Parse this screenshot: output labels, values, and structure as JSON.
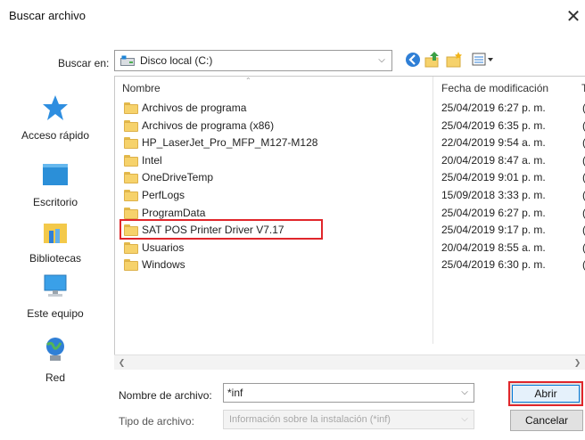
{
  "window": {
    "title": "Buscar archivo",
    "close_glyph": "✕"
  },
  "lookin": {
    "label": "Buscar en:",
    "value": "Disco local (C:)"
  },
  "toolbar": {
    "icons": [
      "back-icon",
      "up-folder-icon",
      "new-folder-icon",
      "view-menu-icon"
    ]
  },
  "places": [
    {
      "label": "Acceso rápido",
      "icon": "star-icon"
    },
    {
      "label": "Escritorio",
      "icon": "desktop-icon"
    },
    {
      "label": "Bibliotecas",
      "icon": "libraries-icon"
    },
    {
      "label": "Este equipo",
      "icon": "computer-icon"
    },
    {
      "label": "Red",
      "icon": "network-icon"
    }
  ],
  "list": {
    "columns": {
      "name": "Nombre",
      "date": "Fecha de modificación",
      "type_partial": "T"
    },
    "rows": [
      {
        "name": "Archivos de programa",
        "date": "25/04/2019 6:27 p. m.",
        "edge": "("
      },
      {
        "name": "Archivos de programa (x86)",
        "date": "25/04/2019 6:35 p. m.",
        "edge": "("
      },
      {
        "name": "HP_LaserJet_Pro_MFP_M127-M128",
        "date": "22/04/2019 9:54 a. m.",
        "edge": "("
      },
      {
        "name": "Intel",
        "date": "20/04/2019 8:47 a. m.",
        "edge": "("
      },
      {
        "name": "OneDriveTemp",
        "date": "25/04/2019 9:01 p. m.",
        "edge": "("
      },
      {
        "name": "PerfLogs",
        "date": "15/09/2018 3:33 p. m.",
        "edge": "("
      },
      {
        "name": "ProgramData",
        "date": "25/04/2019 6:27 p. m.",
        "edge": "("
      },
      {
        "name": "SAT POS Printer Driver V7.17",
        "date": "25/04/2019 9:17 p. m.",
        "edge": "("
      },
      {
        "name": "Usuarios",
        "date": "20/04/2019 8:55 a. m.",
        "edge": "("
      },
      {
        "name": "Windows",
        "date": "25/04/2019 6:30 p. m.",
        "edge": "("
      }
    ]
  },
  "filename": {
    "label": "Nombre de archivo:",
    "value": "*inf"
  },
  "filetype": {
    "label": "Tipo de archivo:",
    "value": "Información sobre la instalación (*inf)"
  },
  "buttons": {
    "open": "Abrir",
    "cancel": "Cancelar"
  },
  "colors": {
    "highlight": "#e0262b",
    "folder": "#f6d26b",
    "accent": "#0078d7"
  }
}
